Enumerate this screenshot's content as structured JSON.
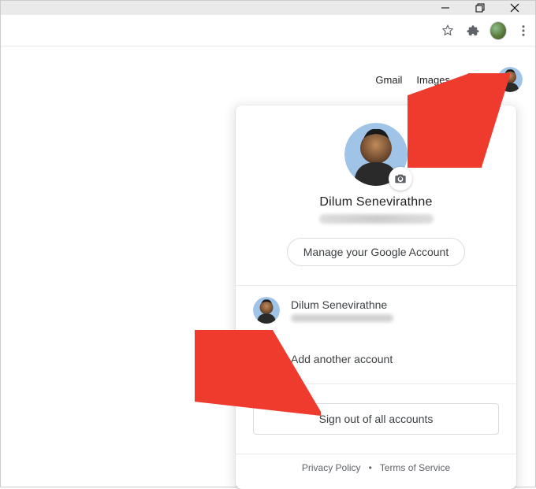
{
  "header": {
    "gmail": "Gmail",
    "images": "Images"
  },
  "account_panel": {
    "primary_name": "Dilum Senevirathne",
    "manage_button": "Manage your Google Account",
    "secondary_name": "Dilum Senevirathne",
    "add_account": "Add another account",
    "sign_out": "Sign out of all accounts",
    "privacy": "Privacy Policy",
    "terms": "Terms of Service"
  }
}
